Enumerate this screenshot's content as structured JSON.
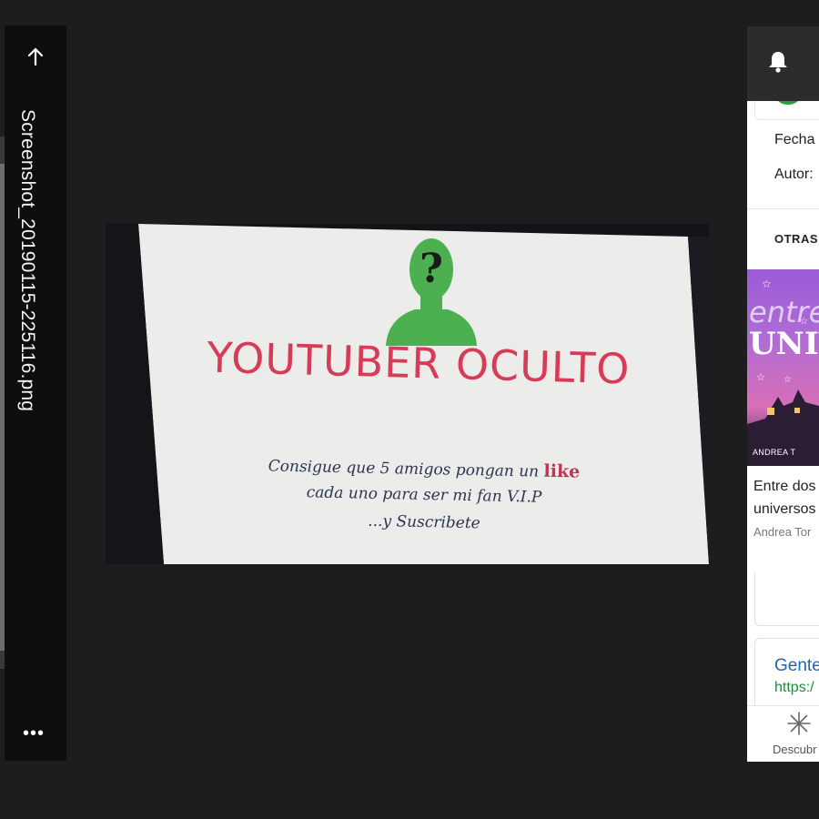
{
  "viewer": {
    "filename": "Screenshot_20190115-225116.png",
    "more_label": "•••"
  },
  "photo": {
    "title": "YOUTUBER  OCULTO",
    "line1_prefix": "Consigue que 5 amigos pongan un ",
    "line1_like": "like",
    "line2": "cada uno para ser mi fan V.I.P",
    "line3": "...y Suscribete",
    "question_mark": "?"
  },
  "phone": {
    "fecha_label": "Fecha",
    "autor_label": "Autor:",
    "otras_label": "OTRAS",
    "book": {
      "cover_word1": "entre",
      "cover_word2": "UNIVER",
      "cover_author": "ANDREA T",
      "title_line1": "Entre dos",
      "title_line2": "universos",
      "author": "Andrea Tor"
    },
    "link": {
      "title": "Gente",
      "url": "https:/"
    },
    "nav": {
      "descubrir_label": "Descubr"
    }
  },
  "colors": {
    "title_red": "#d63b58",
    "silhouette_green": "#4caf50",
    "link_blue": "#1a66b8",
    "url_green": "#1e8e3e"
  }
}
